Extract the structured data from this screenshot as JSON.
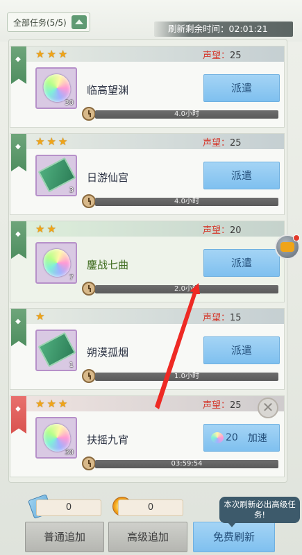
{
  "header": {
    "filter_label": "全部任务(5/5)",
    "refresh_timer_label": "刷新剩余时间：",
    "refresh_timer_value": "02:01:21"
  },
  "tasks": [
    {
      "stars": [
        "★",
        "★",
        "★"
      ],
      "reputation_label": "声望：",
      "reputation_value": "25",
      "name": "临高望渊",
      "item_icon": "rainbow-gem-icon",
      "item_count": "30",
      "action_label": "派遣",
      "duration": "4.0小时"
    },
    {
      "stars": [
        "★",
        "★",
        "★"
      ],
      "reputation_label": "声望：",
      "reputation_value": "25",
      "name": "日游仙宫",
      "item_icon": "ticket-icon",
      "item_count": "3",
      "action_label": "派遣",
      "duration": "4.0小时"
    },
    {
      "stars": [
        "★",
        "★"
      ],
      "reputation_label": "声望：",
      "reputation_value": "20",
      "name": "鏖战七曲",
      "item_icon": "rainbow-gem-icon",
      "item_count": "7",
      "action_label": "派遣",
      "duration": "2.0小时"
    },
    {
      "stars": [
        "★"
      ],
      "reputation_label": "声望：",
      "reputation_value": "15",
      "name": "朔漠孤烟",
      "item_icon": "ticket-icon",
      "item_count": "1",
      "action_label": "派遣",
      "duration": "1.0小时"
    },
    {
      "stars": [
        "★",
        "★",
        "★"
      ],
      "reputation_label": "声望：",
      "reputation_value": "25",
      "name": "扶摇九宵",
      "item_icon": "rainbow-gem-icon",
      "item_count": "30",
      "speedup_cost": "20",
      "action_label": "加速",
      "duration": "03:59:54",
      "close_glyph": "✕"
    }
  ],
  "footer": {
    "normal_count": "0",
    "advanced_count": "0",
    "normal_add_label": "普通追加",
    "advanced_add_label": "高级追加",
    "free_refresh_label": "免费刷新",
    "tooltip_text": "本次刷新必出高级任务!"
  },
  "colors": {
    "reputation": "#d43b2f",
    "button_blue": "#8ec9f2",
    "flag_green": "#5f9a6c",
    "flag_red": "#e0605c",
    "arrow_red": "#ee2a24"
  }
}
